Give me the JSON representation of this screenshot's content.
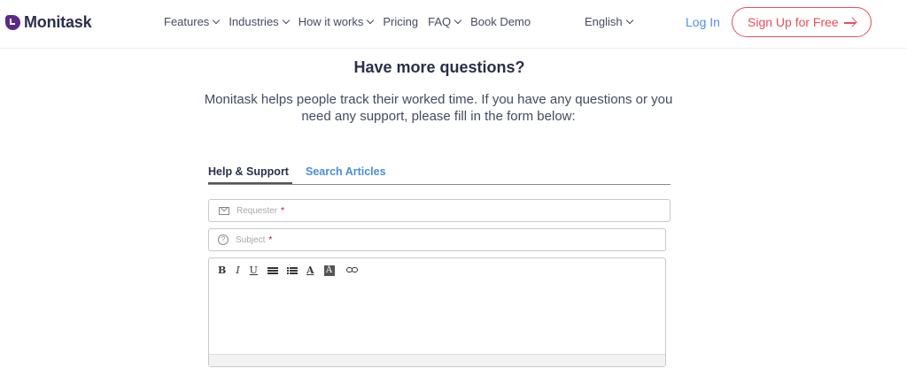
{
  "brand": {
    "name": "Monitask"
  },
  "nav": {
    "items": [
      {
        "label": "Features",
        "dropdown": true
      },
      {
        "label": "Industries",
        "dropdown": true
      },
      {
        "label": "How it works",
        "dropdown": true
      },
      {
        "label": "Pricing",
        "dropdown": false
      },
      {
        "label": "FAQ",
        "dropdown": true
      },
      {
        "label": "Book Demo",
        "dropdown": false
      }
    ],
    "language": "English",
    "login": "Log In",
    "signup": "Sign Up for Free"
  },
  "main": {
    "heading": "Have more questions?",
    "subtext": "Monitask helps people track their worked time. If you have any questions or you need any support, please fill in the form below:"
  },
  "tabs": [
    {
      "label": "Help & Support",
      "active": true
    },
    {
      "label": "Search Articles",
      "active": false
    }
  ],
  "form": {
    "requester_placeholder": "Requester",
    "subject_placeholder": "Subject",
    "required_mark": "*",
    "toolbar": {
      "bold": "B",
      "italic": "I",
      "underline": "U",
      "font_color": "A",
      "bg_color": "A"
    }
  },
  "colors": {
    "accent": "#e84f57",
    "link": "#4f8fe8",
    "brand": "#5b2a86",
    "text": "#2b2f4a"
  }
}
